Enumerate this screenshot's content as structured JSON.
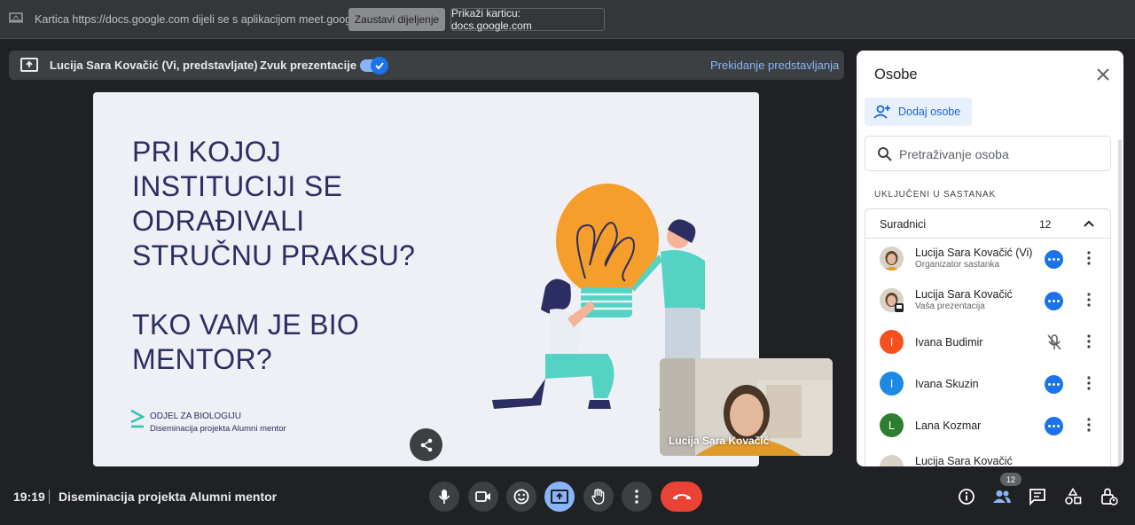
{
  "share_bar": {
    "message": "Kartica https://docs.google.com dijeli se s aplikacijom meet.google.com",
    "stop_sharing": "Zaustavi dijeljenje",
    "show_tab": "Prikaži karticu: docs.google.com"
  },
  "presenting_bar": {
    "presenter": "Lucija Sara Kovačić (Vi, predstavljate)",
    "audio_label": "Zvuk prezentacije",
    "audio_enabled": true,
    "stop_presenting": "Prekidanje predstavljanja"
  },
  "slide": {
    "question_1": "PRI KOJOJ INSTITUCIJI SE ODRAĐIVALI STRUČNU PRAKSU?",
    "question_2": "TKO VAM JE BIO MENTOR?",
    "org": "ODJEL ZA BIOLOGIJU",
    "subtitle": "Diseminacija projekta Alumni mentor"
  },
  "self_view": {
    "name": "Lucija Sara Kovačić"
  },
  "people_panel": {
    "title": "Osobe",
    "add_people": "Dodaj osobe",
    "search_placeholder": "Pretraživanje osoba",
    "section_label": "UKLJUČENI U SASTANAK",
    "group_name": "Suradnici",
    "group_count": "12",
    "participants": [
      {
        "name": "Lucija Sara Kovačić (Vi)",
        "role": "Organizator sastanka",
        "avatar": "photo",
        "status": "more"
      },
      {
        "name": "Lucija Sara Kovačić",
        "role": "Vaša prezentacija",
        "avatar": "photo",
        "status": "more"
      },
      {
        "name": "Ivana Budimir",
        "role": "",
        "initial": "I",
        "color": "#f4511e",
        "status": "muted"
      },
      {
        "name": "Ivana Skuzin",
        "role": "",
        "initial": "I",
        "color": "#1e88e5",
        "status": "more"
      },
      {
        "name": "Lana Kozmar",
        "role": "",
        "initial": "L",
        "color": "#2e7d32",
        "status": "more"
      },
      {
        "name": "Lucija Sara Kovačić",
        "role": "",
        "avatar": "photo",
        "status": "partial"
      }
    ]
  },
  "bottom_bar": {
    "time": "19:19",
    "meeting_name": "Diseminacija projekta Alumni mentor",
    "people_count": "12"
  },
  "colors": {
    "accent": "#8ab4f8",
    "end_call": "#ea4335",
    "slide_text": "#2b2d63"
  }
}
